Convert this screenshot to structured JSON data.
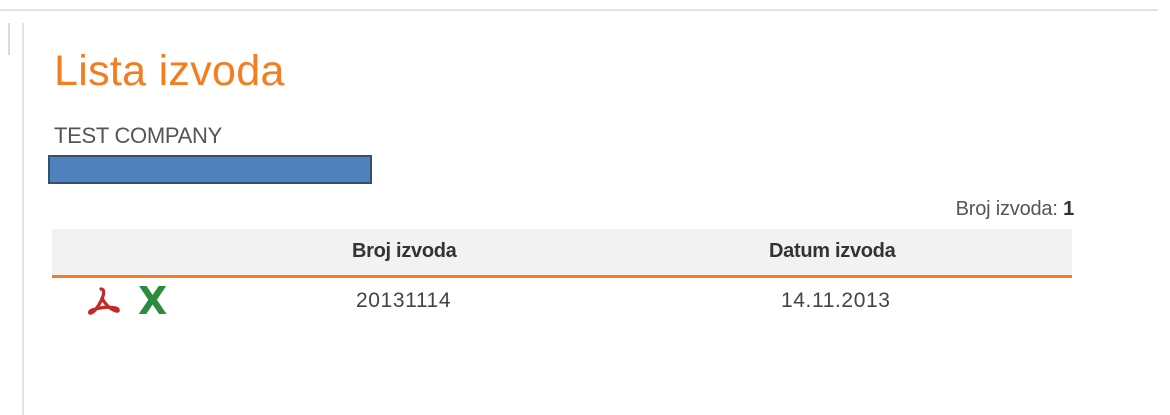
{
  "page": {
    "title": "Lista izvoda",
    "company_name": "TEST COMPANY"
  },
  "summary": {
    "count_label": "Broj izvoda:",
    "count_value": "1"
  },
  "table": {
    "columns": [
      "",
      "Broj izvoda",
      "Datum izvoda"
    ],
    "rows": [
      {
        "actions": [
          "pdf-icon",
          "excel-icon"
        ],
        "excel_glyph": "X",
        "number": "20131114",
        "date": "14.11.2013"
      }
    ]
  },
  "colors": {
    "accent": "#f47e1f",
    "pdf": "#c62828",
    "excel": "#2e8b3e",
    "redaction": "#4f81bd"
  }
}
